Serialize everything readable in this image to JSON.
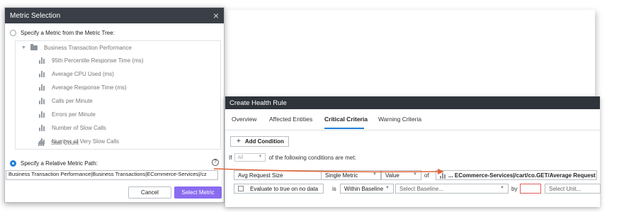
{
  "metric_selection": {
    "title": "Metric Selection",
    "close_glyph": "×",
    "option_tree_label": "Specify a Metric from the Metric Tree:",
    "tree": {
      "root": "Business Transaction Performance",
      "items": [
        "95th Percentile Response Time (ms)",
        "Average CPU Used (ms)",
        "Average Response Time (ms)",
        "Calls per Minute",
        "Errors per Minute",
        "Number of Slow Calls",
        "Number of Very Slow Calls",
        "Stall Count"
      ]
    },
    "option_relative_label": "Specify a Relative Metric Path:",
    "help_glyph": "?",
    "relative_path_value": "Business Transaction Performance|Business Transactions|ECommerce-Services|/cz",
    "cancel_label": "Cancel",
    "select_label": "Select Metric",
    "colors": {
      "title_bar": "#3a3f47",
      "select_button": "#8a6cf0",
      "radio_checked": "#1f7fd7"
    }
  },
  "health_rule": {
    "title": "Create Health Rule",
    "tabs": [
      "Overview",
      "Affected Entities",
      "Critical Criteria",
      "Warning Criteria"
    ],
    "active_tab": "Critical Criteria",
    "add_condition_label": "Add Condition",
    "add_condition_glyph": "+",
    "if_label": "If",
    "if_select_value": "All",
    "if_suffix": "of the following conditions are met:",
    "condition": {
      "name": "Avg Request Size",
      "metric_type": "Single Metric",
      "value_type": "Value",
      "of_label": "of",
      "metric_path": "... ECommerce-Services|/cart/co.GET/Average Request Size",
      "evaluate_label": "Evaluate to true on no data",
      "is_label": "is",
      "baseline_operator": "Within Baseline",
      "baseline_placeholder": "Select Baseline...",
      "by_label": "by",
      "unit_placeholder": "Select Unit..."
    },
    "colors": {
      "title_bar": "#2f343b",
      "tab_underline": "#1f7fd7",
      "arrow": "#e0663a",
      "invalid_input": "#e25b5b"
    }
  }
}
